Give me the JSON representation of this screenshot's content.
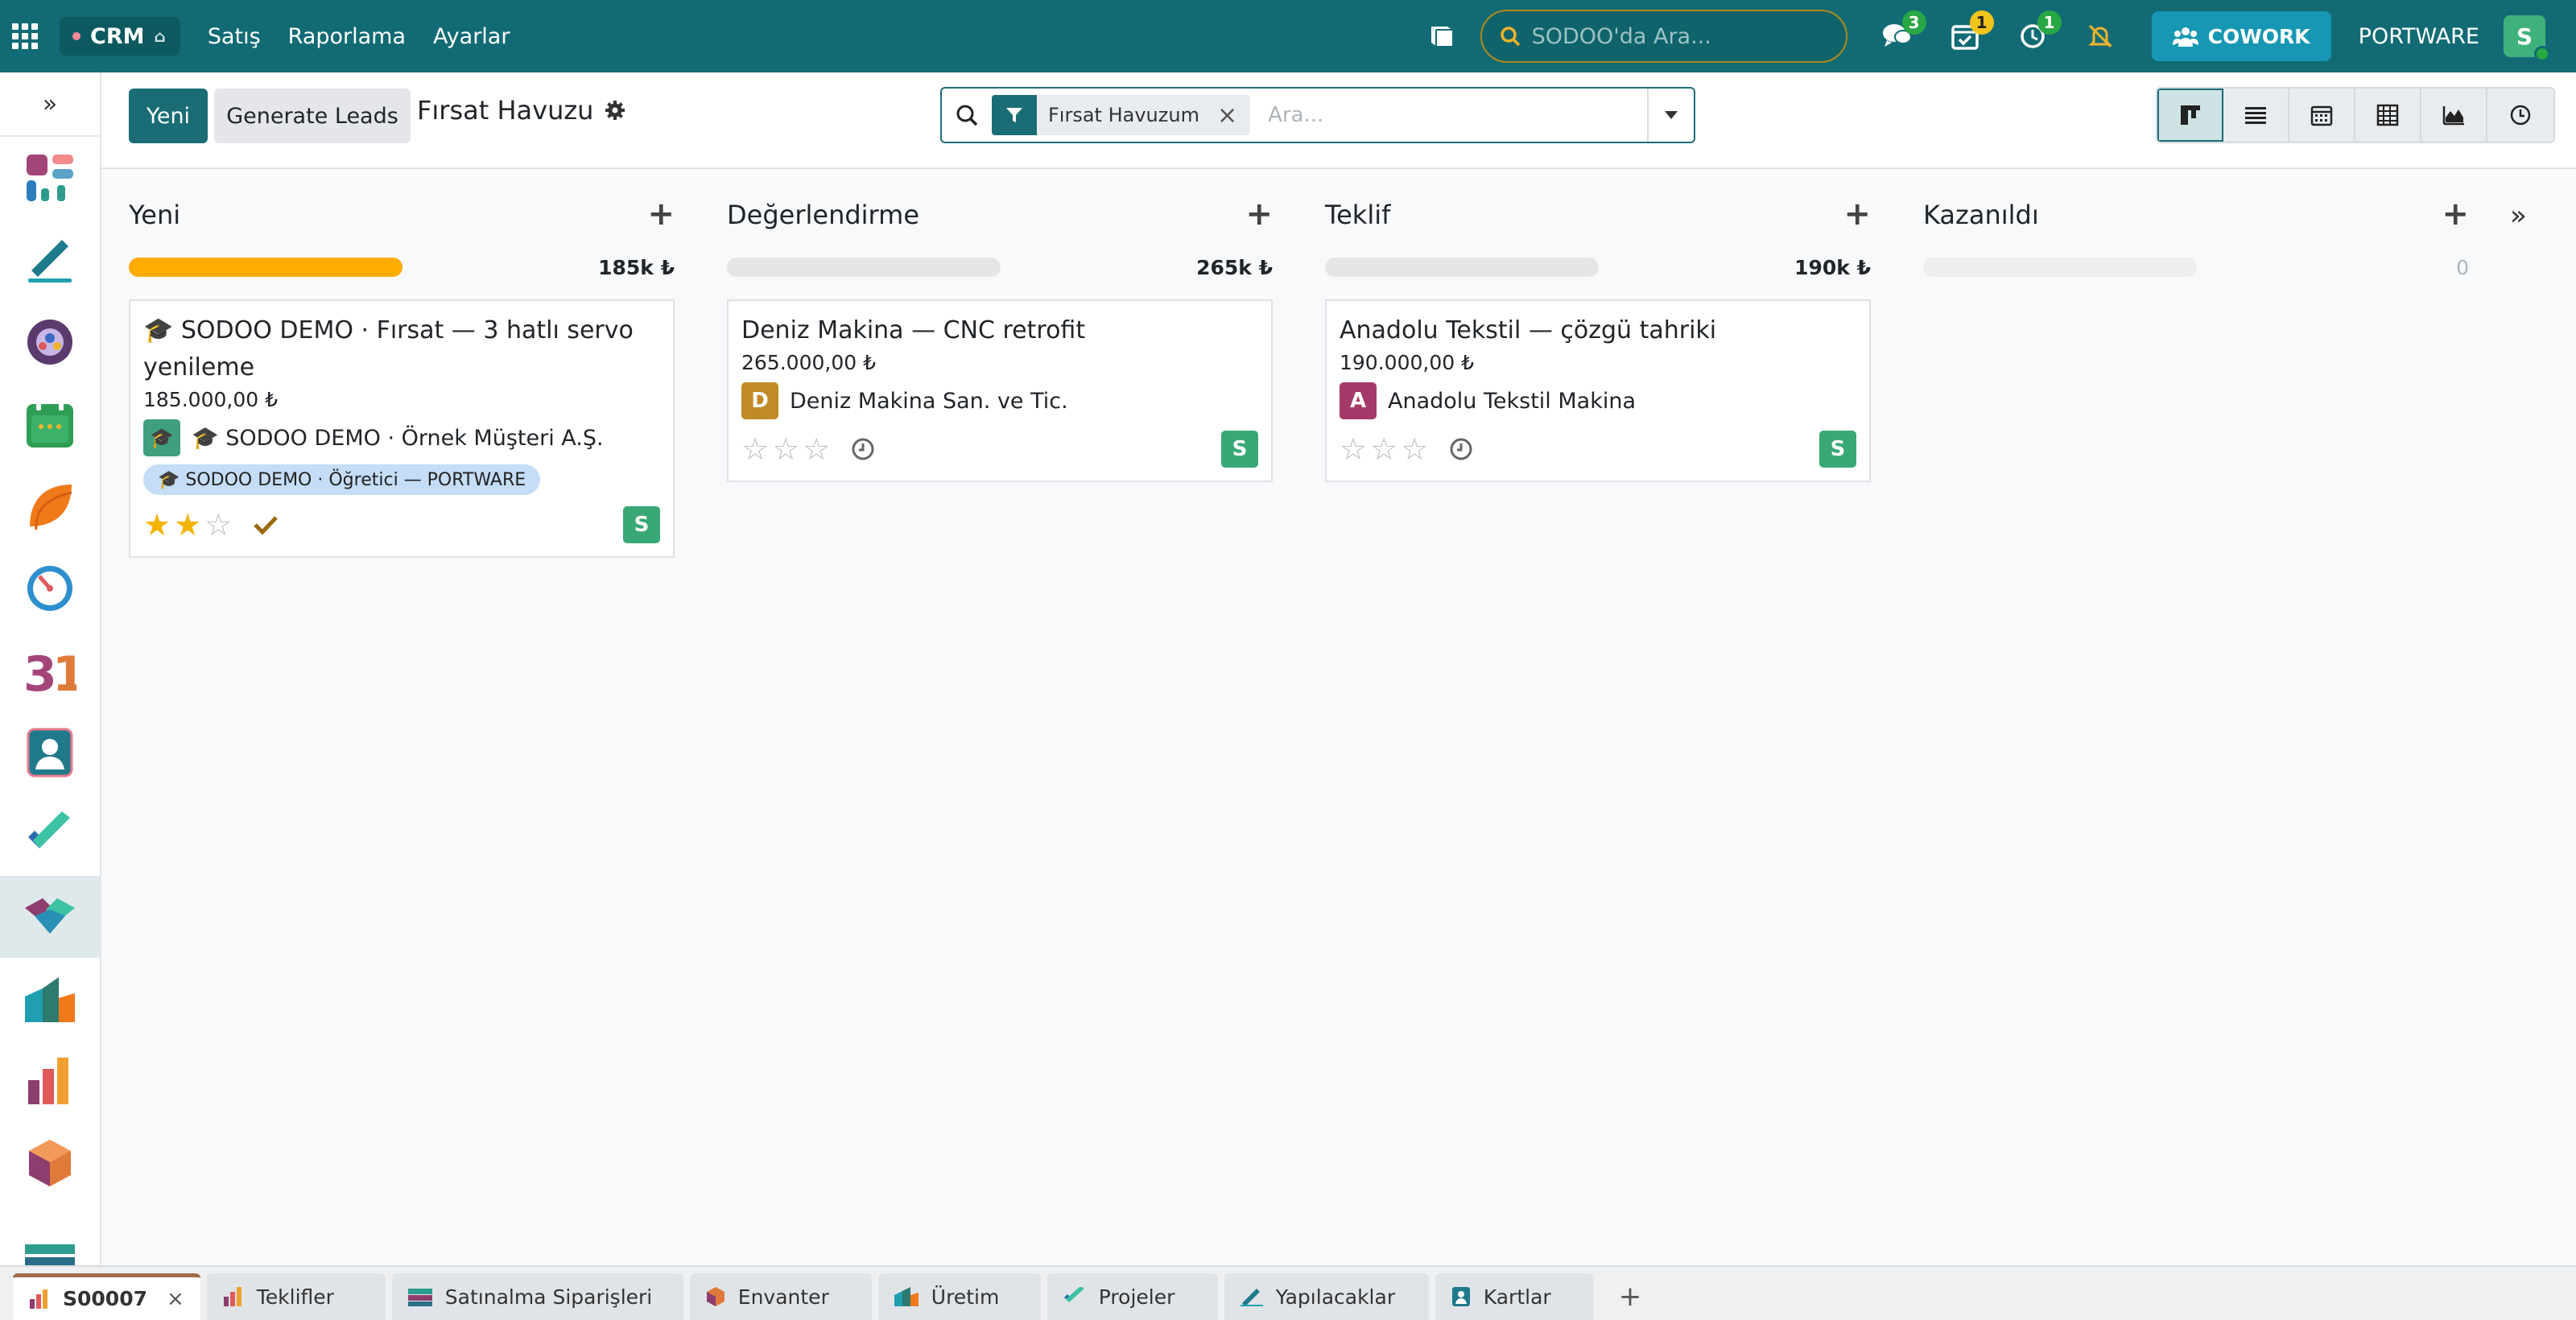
{
  "topbar": {
    "app_name": "CRM",
    "menu": [
      "Satış",
      "Raporlama",
      "Ayarlar"
    ],
    "search_placeholder": "SODOO'da Ara...",
    "messages_count": "3",
    "activities_count": "1",
    "timer_count": "1",
    "cowork_label": "COWORK",
    "company": "PORTWARE",
    "user_initial": "S",
    "accent_color": "#126b74"
  },
  "sidebar": {
    "apps": [
      "dashboards",
      "sign",
      "discuss",
      "calendar-events",
      "leaves",
      "dashboard-gauge",
      "calendar",
      "contacts",
      "todo",
      "crm",
      "inventory-analytics",
      "sales-reports",
      "inventory",
      "other"
    ]
  },
  "control": {
    "new_label": "Yeni",
    "generate_label": "Generate Leads",
    "breadcrumb": "Fırsat Havuzu",
    "facet_label": "Fırsat Havuzum",
    "search_placeholder": "Ara..."
  },
  "columns": [
    {
      "title": "Yeni",
      "sum": "185k ₺",
      "progress": 1.0,
      "cards": [
        {
          "title": "🎓 SODOO DEMO · Fırsat — 3 hatlı servo yenileme",
          "amount": "185.000,00 ₺",
          "partner": "🎓 SODOO DEMO · Örnek Müşteri A.Ş.",
          "partner_initial": "🎓",
          "partner_color": "#3f9f7d",
          "tag": "🎓 SODOO DEMO · Öğretici — PORTWARE",
          "stars": 2,
          "responsible": "S"
        }
      ]
    },
    {
      "title": "Değerlendirme",
      "sum": "265k ₺",
      "progress": 0,
      "cards": [
        {
          "title": "Deniz Makina — CNC retrofit",
          "amount": "265.000,00 ₺",
          "partner": "Deniz Makina San. ve Tic.",
          "partner_initial": "D",
          "partner_color": "#c08a24",
          "stars": 0,
          "responsible": "S"
        }
      ]
    },
    {
      "title": "Teklif",
      "sum": "190k ₺",
      "progress": 0,
      "cards": [
        {
          "title": "Anadolu Tekstil — çözgü tahriki",
          "amount": "190.000,00 ₺",
          "partner": "Anadolu Tekstil Makina",
          "partner_initial": "A",
          "partner_color": "#a43a6a",
          "stars": 0,
          "responsible": "S"
        }
      ]
    },
    {
      "title": "Kazanıldı",
      "sum": "0",
      "progress": 0,
      "cards": []
    }
  ],
  "tabs": [
    {
      "label": "S00007",
      "active": true
    },
    {
      "label": "Teklifler"
    },
    {
      "label": "Satınalma Siparişleri"
    },
    {
      "label": "Envanter"
    },
    {
      "label": "Üretim"
    },
    {
      "label": "Projeler"
    },
    {
      "label": "Yapılacaklar"
    },
    {
      "label": "Kartlar"
    }
  ]
}
